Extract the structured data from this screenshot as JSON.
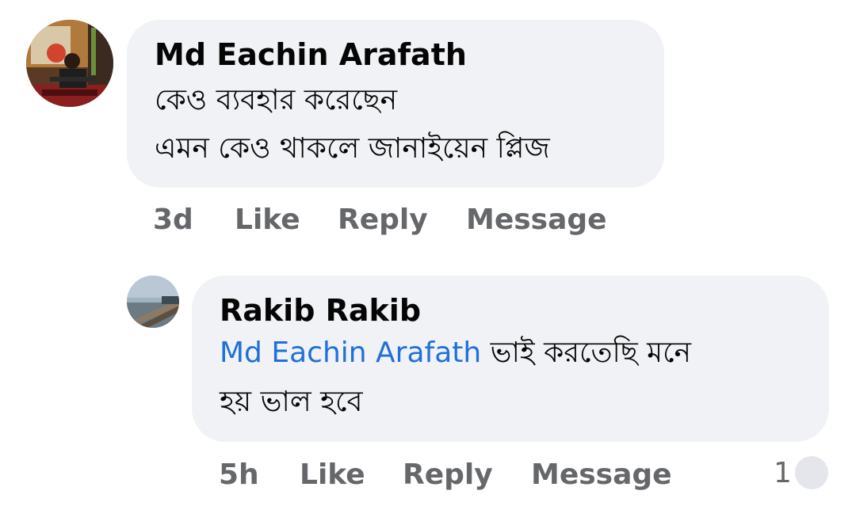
{
  "comments": [
    {
      "author": "Md Eachin Arafath",
      "lines": [
        "কেও ব্যবহার করেছেন",
        "এমন কেও থাকলে জানাইয়েন প্লিজ"
      ],
      "time": "3d",
      "actions": {
        "like": "Like",
        "reply": "Reply",
        "message": "Message"
      }
    },
    {
      "author": "Rakib Rakib",
      "mention": "Md Eachin Arafath",
      "line1_rest": " ভাই করতেছি  মনে",
      "line2": "হয় ভাল হবে",
      "time": "5h",
      "actions": {
        "like": "Like",
        "reply": "Reply",
        "message": "Message"
      },
      "reaction_count": "1"
    }
  ],
  "colors": {
    "bubble": "#f0f2f5",
    "meta_text": "#65676b",
    "mention": "#216fdb"
  }
}
